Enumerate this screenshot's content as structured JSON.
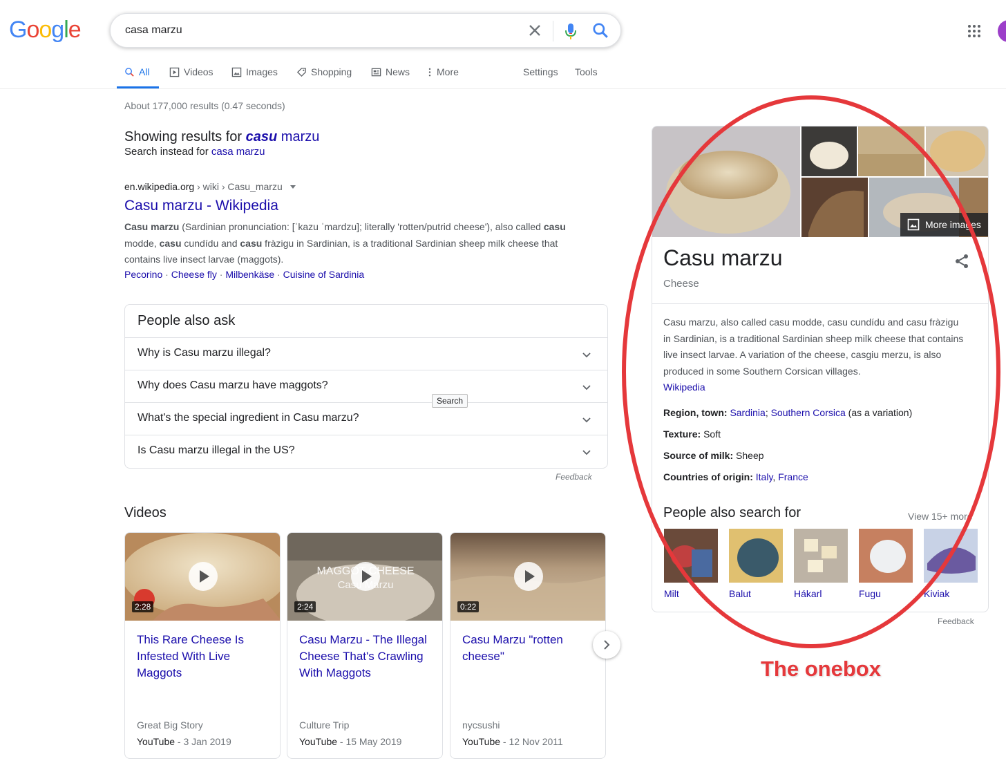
{
  "logo": {
    "letters": [
      "G",
      "o",
      "o",
      "g",
      "l",
      "e"
    ],
    "colors": [
      "#4285f4",
      "#ea4335",
      "#fbbc05",
      "#4285f4",
      "#34a853",
      "#ea4335"
    ]
  },
  "search": {
    "query": "casa marzu"
  },
  "tabs": [
    {
      "label": "All",
      "icon": "search-icon",
      "active": true
    },
    {
      "label": "Videos",
      "icon": "video-icon"
    },
    {
      "label": "Images",
      "icon": "image-icon"
    },
    {
      "label": "Shopping",
      "icon": "tag-icon"
    },
    {
      "label": "News",
      "icon": "news-icon"
    },
    {
      "label": "More",
      "icon": "more-vertical-icon"
    },
    {
      "label": "Settings"
    },
    {
      "label": "Tools"
    }
  ],
  "stats": "About 177,000 results (0.47 seconds)",
  "correction": {
    "prefix": "Showing results for ",
    "corrected_bold": "casu",
    "corrected_rest": " marzu",
    "instead_prefix": "Search instead for ",
    "instead_query": "casa marzu"
  },
  "result": {
    "domain": "en.wikipedia.org",
    "path": " › wiki › Casu_marzu",
    "title": "Casu marzu - Wikipedia",
    "snippet": [
      {
        "b": "Casu marzu"
      },
      {
        "t": " (Sardinian pronunciation: [ˈkazu ˈmardzu]; literally 'rotten/putrid cheese'), also called "
      },
      {
        "b": "casu"
      },
      {
        "t": " modde, "
      },
      {
        "b": "casu"
      },
      {
        "t": " cundídu and "
      },
      {
        "b": "casu"
      },
      {
        "t": " fràzigu in Sardinian, is a traditional Sardinian sheep milk cheese that contains live insect larvae (maggots)."
      }
    ],
    "sitelinks": [
      "Pecorino",
      "Cheese fly",
      "Milbenkäse",
      "Cuisine of Sardinia"
    ]
  },
  "paa": {
    "title": "People also ask",
    "questions": [
      "Why is Casu marzu illegal?",
      "Why does Casu marzu have maggots?",
      "What's the special ingredient in Casu marzu?",
      "Is Casu marzu illegal in the US?"
    ],
    "tooltip": "Search",
    "feedback": "Feedback"
  },
  "videos": {
    "title": "Videos",
    "items": [
      {
        "duration": "2:28",
        "title": "This Rare Cheese Is Infested With Live Maggots",
        "channel": "Great Big Story",
        "source": "YouTube",
        "date": " - 3 Jan 2019"
      },
      {
        "duration": "2:24",
        "title": "Casu Marzu - The Illegal Cheese That's Crawling With Maggots",
        "channel": "Culture Trip",
        "source": "YouTube",
        "date": " - 15 May 2019",
        "overlay1": "MAGGOT CHEESE",
        "overlay2": "Casu Marzu"
      },
      {
        "duration": "0:22",
        "title": "Casu Marzu \"rotten cheese\"",
        "channel": "nycsushi",
        "source": "YouTube",
        "date": " - 12 Nov 2011"
      }
    ]
  },
  "kp": {
    "more_images": "More images",
    "title": "Casu marzu",
    "subtitle": "Cheese",
    "description": "Casu marzu, also called casu modde, casu cundídu and casu fràzigu in Sardinian, is a traditional Sardinian sheep milk cheese that contains live insect larvae. A variation of the cheese, casgiu merzu, is also produced in some Southern Corsican villages.",
    "source": "Wikipedia",
    "region_label": "Region, town:",
    "region_link1": "Sardinia",
    "region_sep": "; ",
    "region_link2": "Southern Corsica",
    "region_rest": " (as a variation)",
    "texture_label": "Texture:",
    "texture_value": " Soft",
    "milk_label": "Source of milk:",
    "milk_value": " Sheep",
    "countries_label": "Countries of origin:",
    "country1": "Italy",
    "country_sep": ", ",
    "country2": "France",
    "pasf_title": "People also search for",
    "pasf_more": "View 15+ more",
    "pasf": [
      "Milt",
      "Balut",
      "Hákarl",
      "Fugu",
      "Kiviak"
    ],
    "feedback": "Feedback"
  },
  "annotation": {
    "label": "The onebox",
    "color": "#e5383b"
  }
}
